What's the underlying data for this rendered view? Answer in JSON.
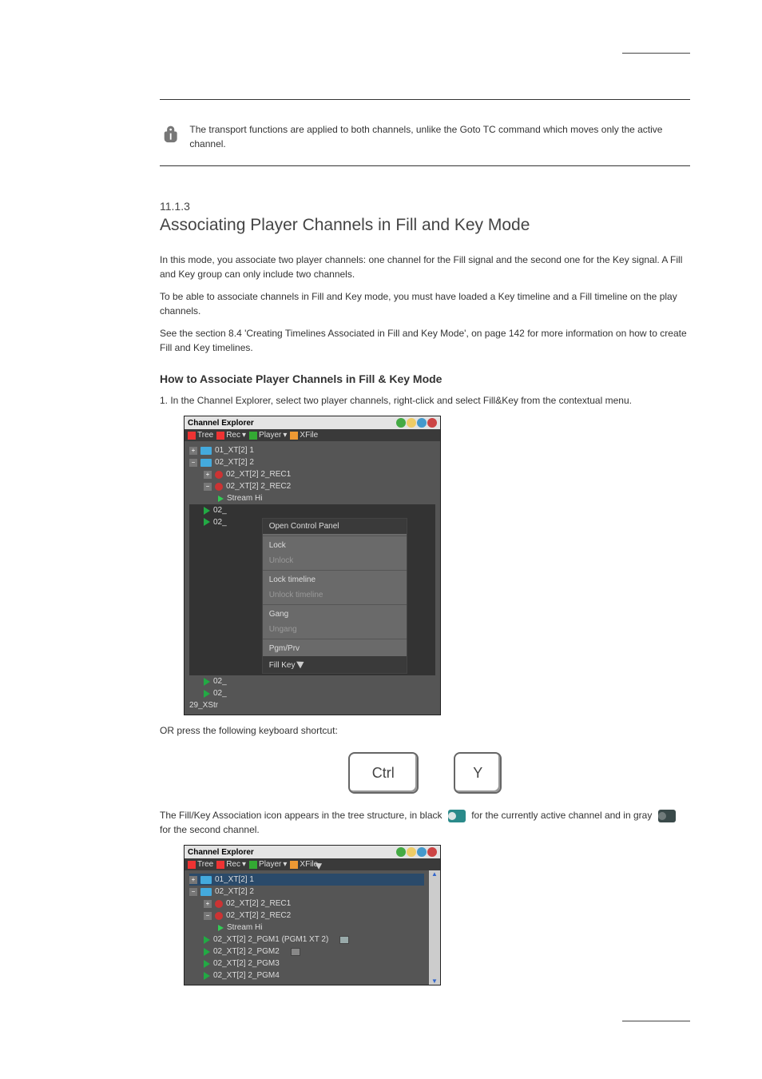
{
  "note": {
    "text": "The transport functions are applied to both channels, unlike the Goto TC command which moves only the active channel."
  },
  "section": {
    "number": "11.1.3",
    "title": "Associating Player Channels in Fill and Key Mode",
    "intro1": "In this mode, you associate two player channels: one channel for the Fill signal and the second one for the Key signal. A Fill and Key group can only include two channels.",
    "intro2": "To be able to associate channels in Fill and Key mode, you must have loaded a Key timeline and a Fill timeline on the play channels.",
    "intro3": "See the section 8.4 'Creating Timelines Associated in Fill and Key Mode', on page 142 for more information on how to create Fill and Key timelines.",
    "howto_head": "How to Associate Player Channels in Fill & Key Mode",
    "step1": "1.   In the Channel Explorer, select two player channels, right-click and select Fill&Key from the contextual menu.",
    "or_text": "OR press the following keyboard shortcut:",
    "result1": "The Fill/Key Association icon appears in the tree structure, in black ",
    "result2": " for the currently active channel and in gray ",
    "result3": " for the second channel."
  },
  "keys": {
    "ctrl": "Ctrl",
    "y": "Y"
  },
  "ce": {
    "title": "Channel Explorer",
    "tb": {
      "tree": "Tree",
      "rec": "Rec",
      "player": "Player",
      "xfile": "XFile"
    },
    "tree": [
      "01_XT[2] 1",
      "02_XT[2] 2",
      "02_XT[2] 2_REC1",
      "02_XT[2] 2_REC2",
      "Stream Hi",
      "02_",
      "02_",
      "02_",
      "02_",
      "29_XStr"
    ],
    "menu": [
      "Open Control Panel",
      "Lock",
      "Unlock",
      "Lock timeline",
      "Unlock timeline",
      "Gang",
      "Ungang",
      "Pgm/Prv",
      "Fill Key"
    ]
  },
  "ce2": {
    "tree": [
      "01_XT[2] 1",
      "02_XT[2] 2",
      "02_XT[2] 2_REC1",
      "02_XT[2] 2_REC2",
      "Stream Hi",
      "02_XT[2] 2_PGM1 (PGM1 XT 2)",
      "02_XT[2] 2_PGM2",
      "02_XT[2] 2_PGM3",
      "02_XT[2] 2_PGM4"
    ]
  }
}
